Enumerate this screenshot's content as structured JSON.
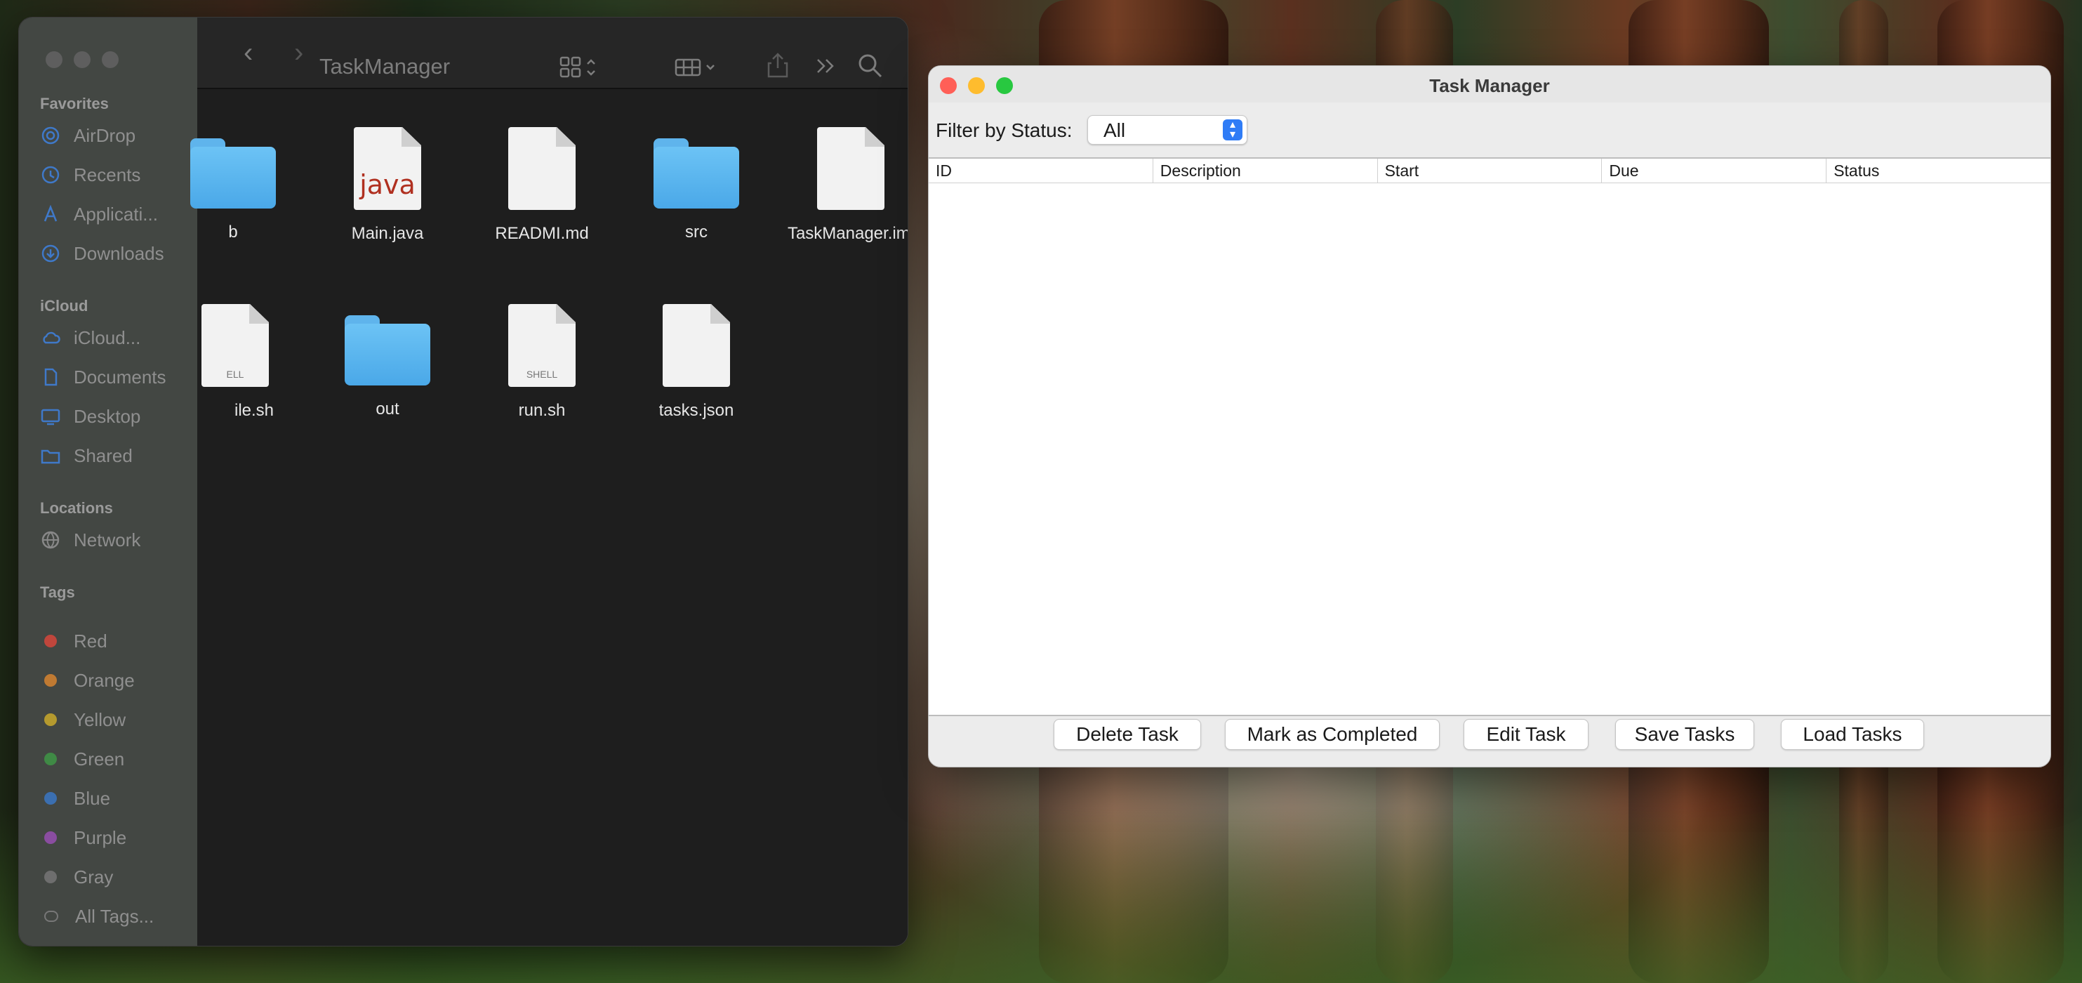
{
  "finder": {
    "title": "TaskManager",
    "sidebar": {
      "favorites_title": "Favorites",
      "favorites": [
        {
          "label": "AirDrop",
          "icon": "airdrop-icon"
        },
        {
          "label": "Recents",
          "icon": "clock-icon"
        },
        {
          "label": "Applicati...",
          "icon": "applications-icon"
        },
        {
          "label": "Downloads",
          "icon": "download-icon"
        }
      ],
      "icloud_title": "iCloud",
      "icloud": [
        {
          "label": "iCloud...",
          "icon": "cloud-icon"
        },
        {
          "label": "Documents",
          "icon": "document-icon"
        },
        {
          "label": "Desktop",
          "icon": "desktop-icon"
        },
        {
          "label": "Shared",
          "icon": "shared-folder-icon"
        }
      ],
      "locations_title": "Locations",
      "locations": [
        {
          "label": "Network",
          "icon": "globe-icon"
        }
      ],
      "tags_title": "Tags",
      "tags": [
        {
          "label": "Red",
          "color": "#c0463c"
        },
        {
          "label": "Orange",
          "color": "#c07a32"
        },
        {
          "label": "Yellow",
          "color": "#b59a2e"
        },
        {
          "label": "Green",
          "color": "#3f8a45"
        },
        {
          "label": "Blue",
          "color": "#3b6fb0"
        },
        {
          "label": "Purple",
          "color": "#8a4da0"
        },
        {
          "label": "Gray",
          "color": "#6e6e6e"
        },
        {
          "label": "All Tags...",
          "color": "none"
        }
      ]
    },
    "files": [
      {
        "label": "b",
        "kind": "folder"
      },
      {
        "label": "Main.java",
        "kind": "java",
        "badge": "java"
      },
      {
        "label": "READMI.md",
        "kind": "doc"
      },
      {
        "label": "src",
        "kind": "folder"
      },
      {
        "label": "TaskManager.iml",
        "kind": "doc"
      },
      {
        "label": "ile.sh",
        "kind": "shell",
        "badge": "ELL"
      },
      {
        "label": "out",
        "kind": "folder"
      },
      {
        "label": "run.sh",
        "kind": "shell",
        "badge": "SHELL"
      },
      {
        "label": "tasks.json",
        "kind": "doc"
      }
    ]
  },
  "task_manager": {
    "title": "Task Manager",
    "filter_label": "Filter by Status:",
    "filter_value": "All",
    "columns": [
      "ID",
      "Description",
      "Start",
      "Due",
      "Status"
    ],
    "buttons": {
      "delete": "Delete Task",
      "complete": "Mark as Completed",
      "edit": "Edit Task",
      "save": "Save Tasks",
      "load": "Load Tasks"
    }
  }
}
